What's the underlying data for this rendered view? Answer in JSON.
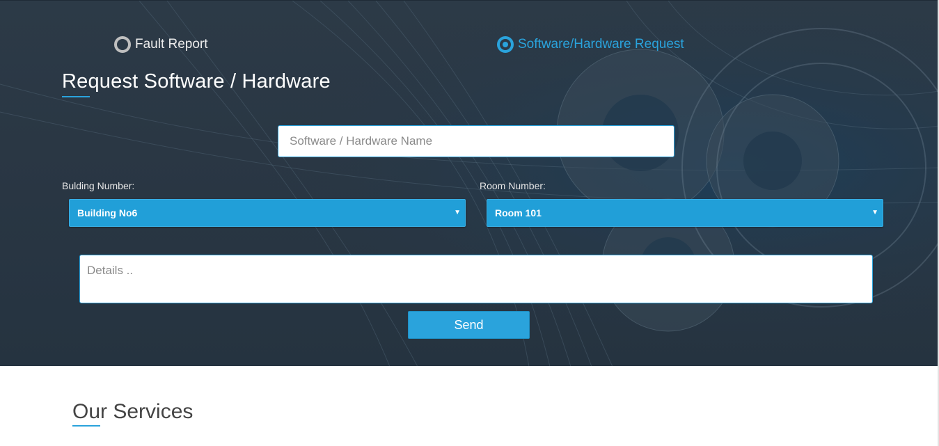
{
  "request_type": {
    "options": [
      {
        "label": "Fault Report",
        "selected": false
      },
      {
        "label": "Software/Hardware Request",
        "selected": true
      }
    ]
  },
  "form": {
    "title": "Request Software / Hardware",
    "name_placeholder": "Software / Hardware Name",
    "building_label": "Bulding Number:",
    "building_value": "Building No6",
    "room_label": "Room Number:",
    "room_value": "Room 101",
    "details_placeholder": "Details ..",
    "send_label": "Send"
  },
  "services": {
    "title": "Our Services"
  },
  "colors": {
    "accent": "#2aa3dc",
    "hero_background": "#2c3a47",
    "select_background": "#219fd8"
  },
  "icons": {
    "select_arrow": "caret-down-icon",
    "radio": "radio-icon"
  }
}
